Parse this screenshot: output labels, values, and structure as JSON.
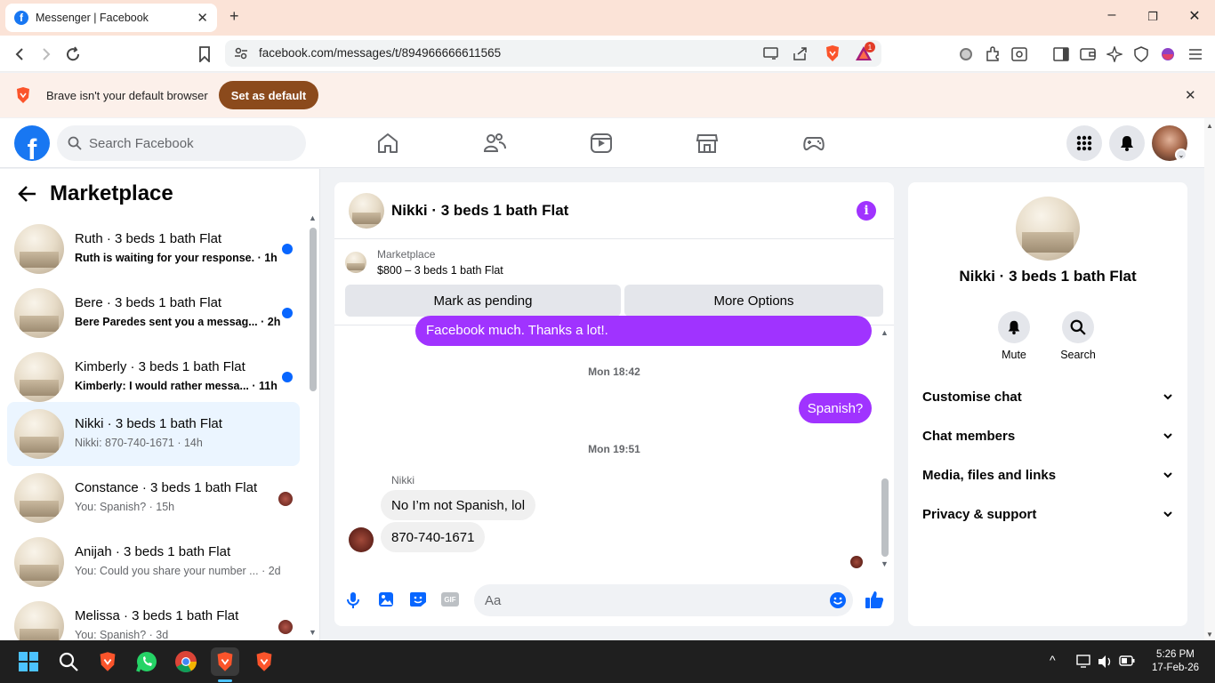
{
  "browser": {
    "tab_title": "Messenger | Facebook",
    "url": "facebook.com/messages/t/894966666611565",
    "notification_count": "1",
    "banner_text": "Brave isn't your default browser",
    "banner_button": "Set as default"
  },
  "header": {
    "search_placeholder": "Search Facebook"
  },
  "sidebar": {
    "title": "Marketplace",
    "conversations": [
      {
        "name": "Ruth · 3 beds 1 bath Flat",
        "preview": "Ruth is waiting for your response. · 1h",
        "unread": true
      },
      {
        "name": "Bere · 3 beds 1 bath Flat",
        "preview": "Bere Paredes sent you a messag... · 2h",
        "unread": true
      },
      {
        "name": "Kimberly · 3 beds 1 bath Flat",
        "preview": "Kimberly: I would rather messa... · 11h",
        "unread": true
      },
      {
        "name": "Nikki · 3 beds 1 bath Flat",
        "preview": "Nikki: 870-740-1671 · 14h",
        "unread": false
      },
      {
        "name": "Constance · 3 beds 1 bath Flat",
        "preview": "You: Spanish? · 15h",
        "unread": false
      },
      {
        "name": "Anijah · 3 beds 1 bath Flat",
        "preview": "You: Could you share your number ... · 2d",
        "unread": false
      },
      {
        "name": "Melissa · 3 beds 1 bath Flat",
        "preview": "You: Spanish? · 3d",
        "unread": false
      }
    ]
  },
  "chat": {
    "title": "Nikki · 3 beds 1 bath Flat",
    "listing_label": "Marketplace",
    "listing_price": "$800 – 3 beds 1 bath Flat",
    "mark_pending": "Mark as pending",
    "more_options": "More Options",
    "messages": {
      "cut_off_out": "Facebook much. Thanks a lot!.",
      "time1": "Mon 18:42",
      "out1": "Spanish?",
      "time2": "Mon 19:51",
      "sender": "Nikki",
      "in1": "No I’m not Spanish, lol",
      "in2": "870-740-1671"
    },
    "input_placeholder": "Aa"
  },
  "details": {
    "name": "Nikki · 3 beds 1 bath Flat",
    "mute": "Mute",
    "search": "Search",
    "sections": [
      "Customise chat",
      "Chat members",
      "Media, files and links",
      "Privacy & support"
    ]
  },
  "taskbar": {
    "time": "5:26 PM",
    "date": "17-Feb-26"
  },
  "colors": {
    "fb_blue": "#1877f2",
    "messenger_purple": "#a033ff",
    "unread_dot": "#0866ff",
    "brave_button": "#8b4a1c"
  }
}
